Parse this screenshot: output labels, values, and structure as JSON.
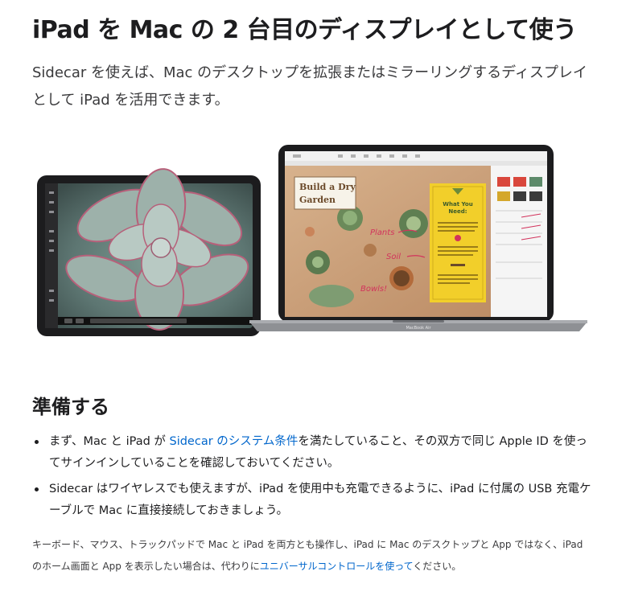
{
  "title": "iPad を Mac の 2 台目のディスプレイとして使う",
  "intro": "Sidecar を使えば、Mac のデスクトップを拡張またはミラーリングするディスプレイとして iPad を活用できます。",
  "hero": {
    "poster_title": "Build a Dry Garden",
    "poster_heading": "What You Need:",
    "annotations": [
      "Plants",
      "Soil",
      "Bowls!"
    ],
    "laptop_label": "MacBook Air"
  },
  "section_heading": "準備する",
  "bullets": [
    {
      "before": "まず、Mac と iPad が ",
      "link": "Sidecar のシステム条件",
      "after": "を満たしていること、その双方で同じ Apple ID を使ってサインインしていることを確認しておいてください。"
    },
    {
      "text": "Sidecar はワイヤレスでも使えますが、iPad を使用中も充電できるように、iPad に付属の USB 充電ケーブルで Mac に直接接続しておきましょう。"
    }
  ],
  "note": {
    "before": "キーボード、マウス、トラックパッドで Mac と iPad を両方とも操作し、iPad に Mac のデスクトップと App ではなく、iPad のホーム画面と App を表示したい場合は、代わりに",
    "link": "ユニバーサルコントロールを使って",
    "after": "ください。"
  },
  "colors": {
    "link": "#0066cc",
    "text": "#1d1d1f",
    "poster_yellow": "#f2cf2a",
    "annotation_pink": "#d2335c"
  }
}
